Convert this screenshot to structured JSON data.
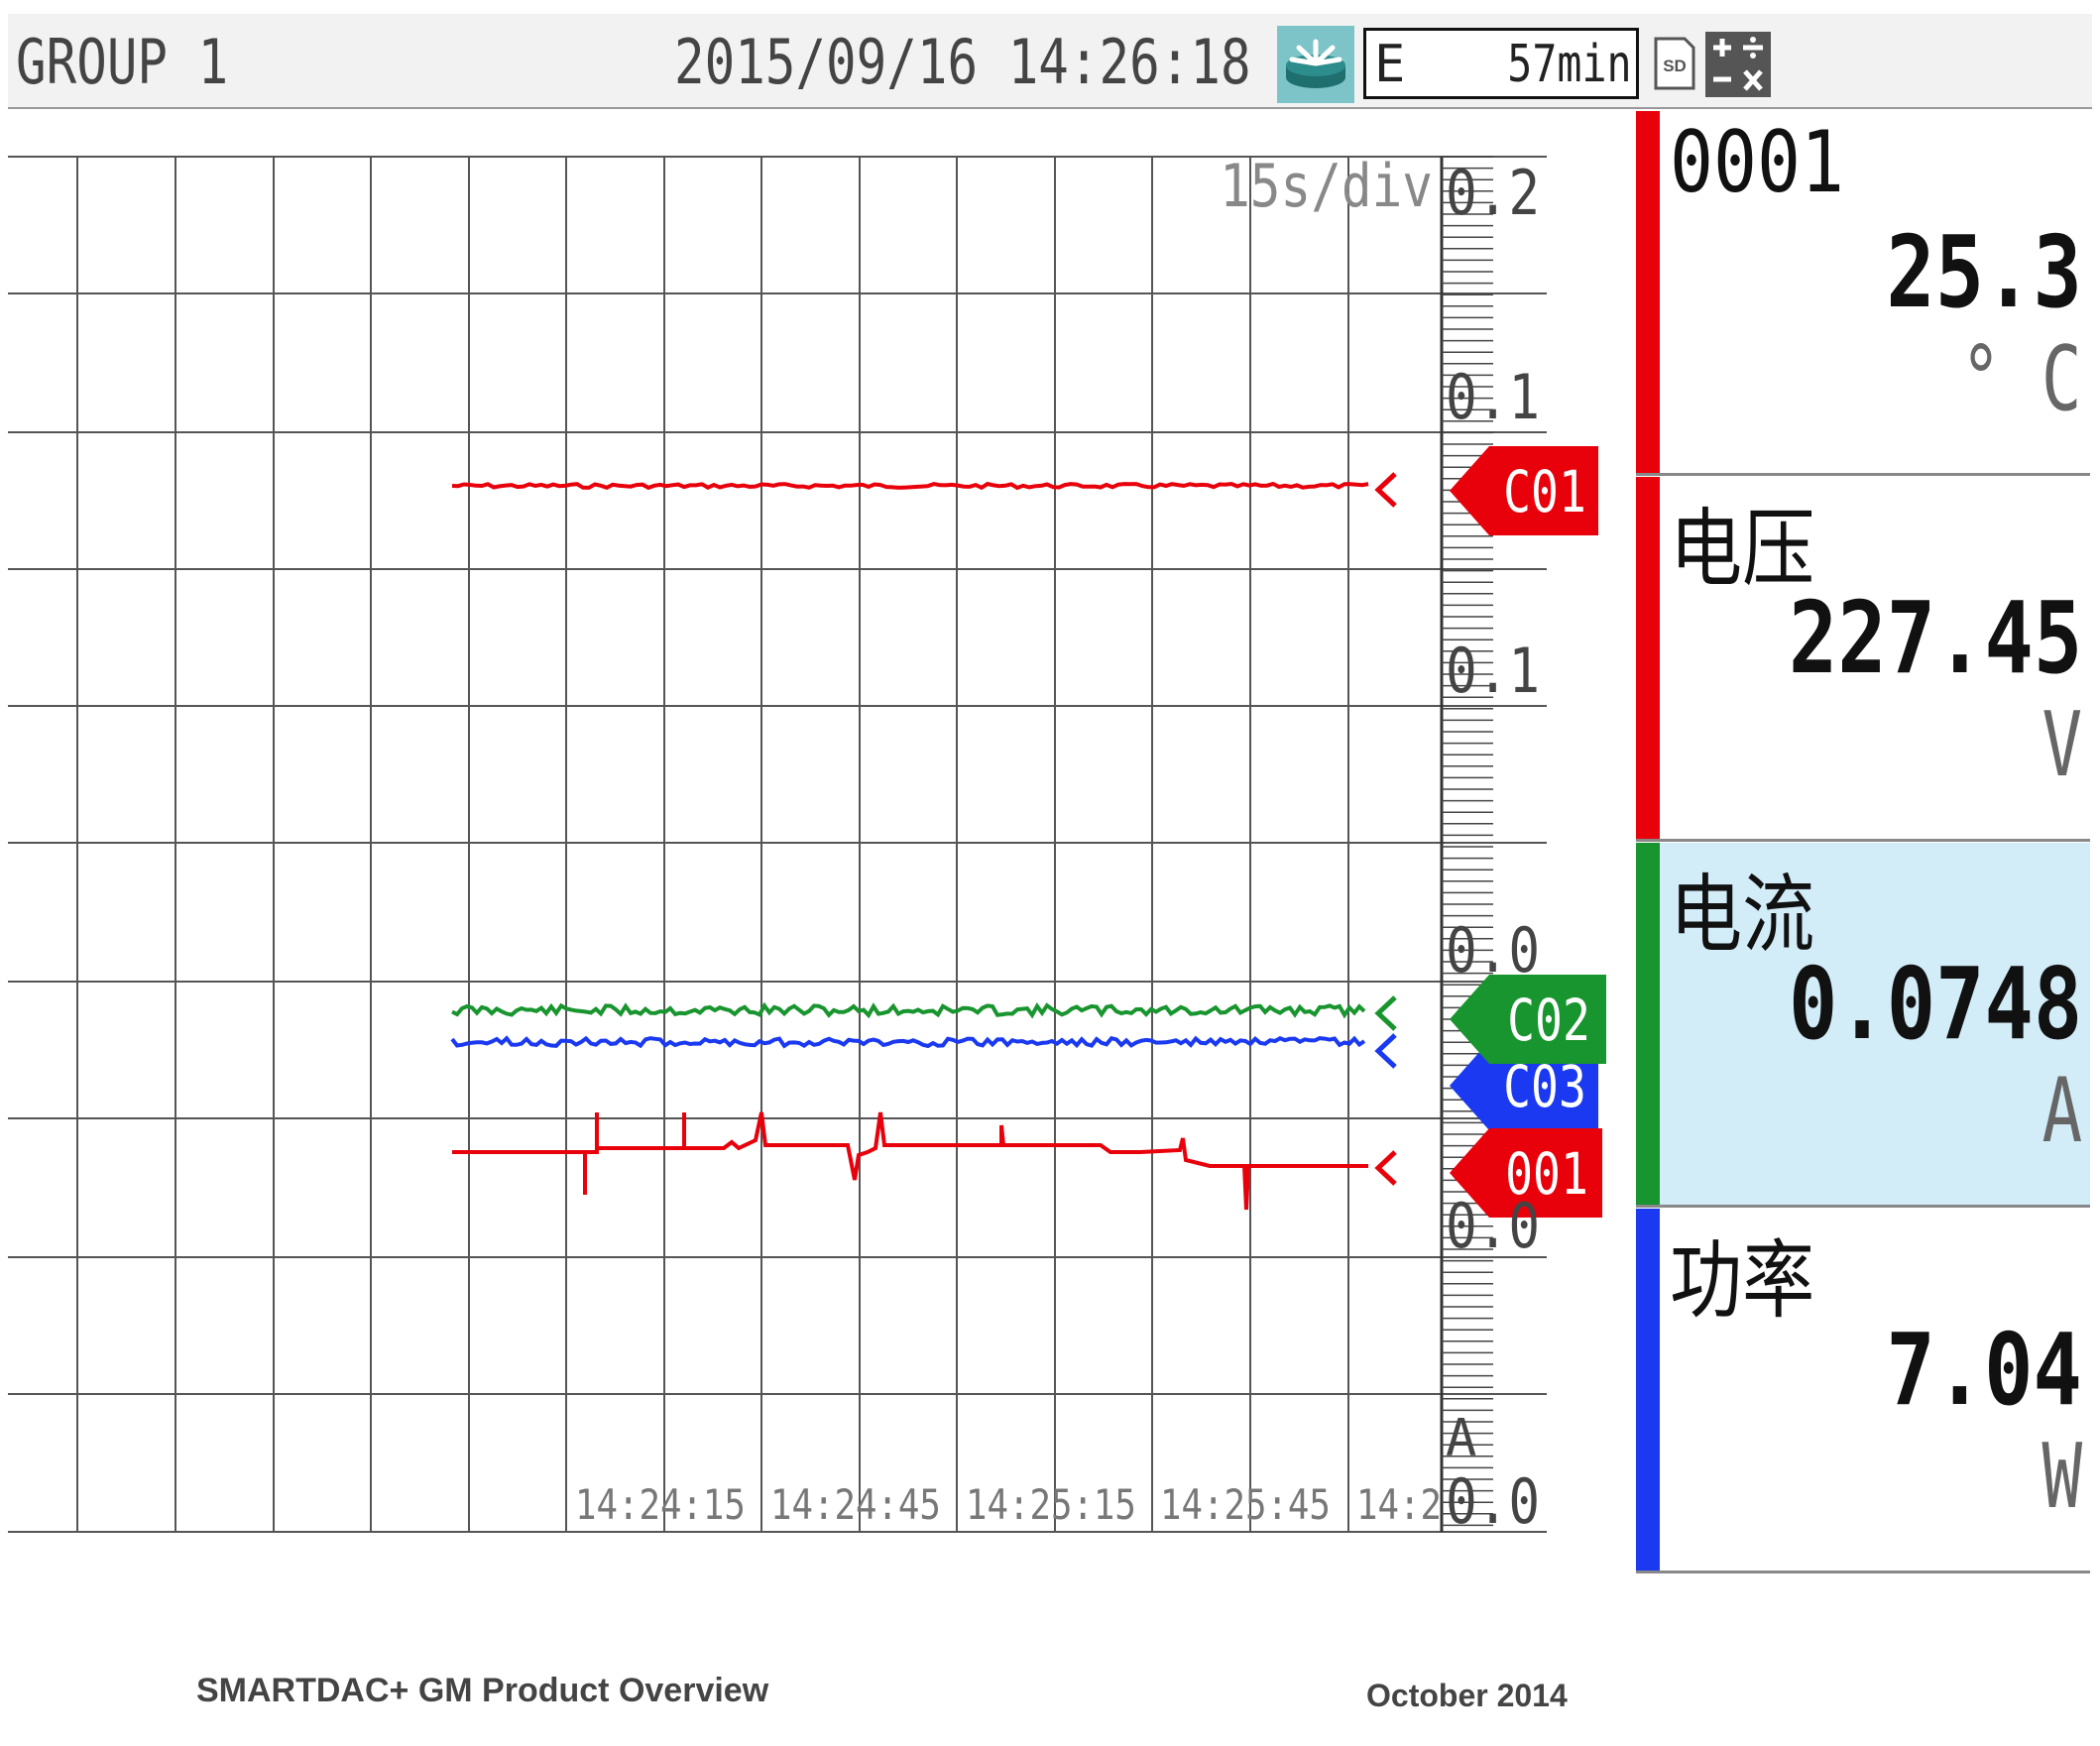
{
  "header": {
    "group_title": "GROUP 1",
    "datetime": "2015/09/16 14:26:18",
    "memory_mode": "E",
    "memory_remaining": "57min",
    "sd_label": "SD"
  },
  "trend": {
    "time_per_div": "15s/div",
    "time_labels": [
      "14:24:15",
      "14:24:45",
      "14:25:15",
      "14:25:45",
      "14:2"
    ],
    "scale_labels": [
      "0.2",
      "0.1",
      "0.1",
      "0.0",
      "0.0",
      "0.0"
    ],
    "scale_unit": "A",
    "markers": [
      {
        "label": "C01",
        "color": "#e8000b"
      },
      {
        "label": "C02",
        "color": "#18952e"
      },
      {
        "label": "C03",
        "color": "#1a39f0"
      },
      {
        "label": "001",
        "color": "#e8000b"
      }
    ]
  },
  "channels": [
    {
      "tag": "0001",
      "value": "25.3",
      "unit": "° C",
      "color": "#e8000b",
      "highlight": false
    },
    {
      "tag": "电压",
      "value": "227.45",
      "unit": "V",
      "color": "#e8000b",
      "highlight": false
    },
    {
      "tag": "电流",
      "value": "0.0748",
      "unit": "A",
      "color": "#18952e",
      "highlight": true
    },
    {
      "tag": "功率",
      "value": "7.04",
      "unit": "W",
      "color": "#1a39f0",
      "highlight": false
    }
  ],
  "footer": {
    "left": "SMARTDAC+ GM Product Overview",
    "right": "October 2014"
  }
}
